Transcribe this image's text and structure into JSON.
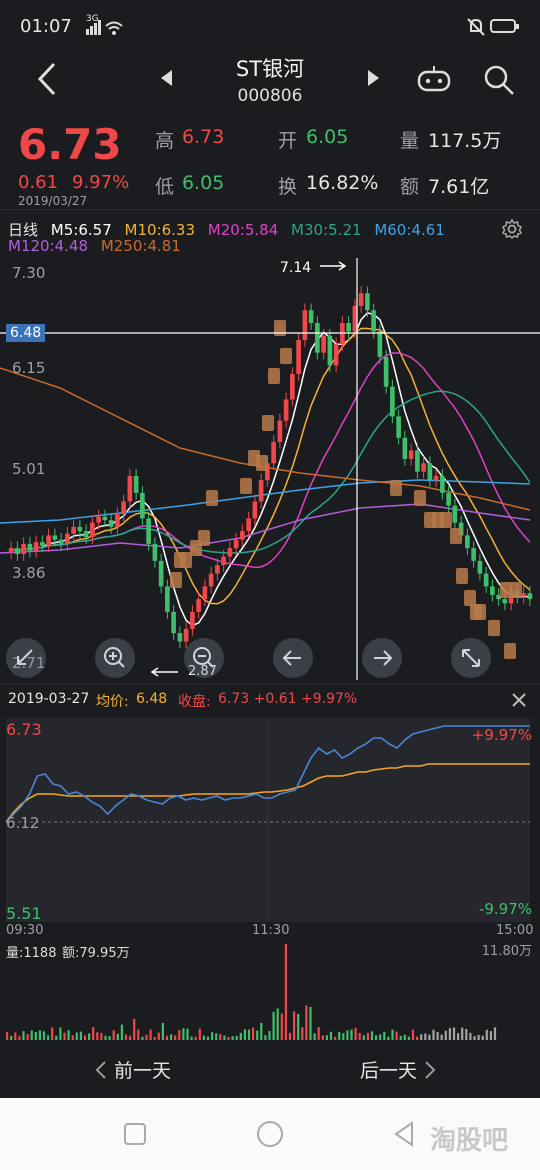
{
  "status_bar": {
    "time": "01:07",
    "signal": "3G",
    "battery": "battery"
  },
  "nav": {
    "title": "ST银河",
    "code": "000806"
  },
  "quote": {
    "price": "6.73",
    "change": "0.61",
    "change_pct": "9.97%",
    "date": "2019/03/27",
    "high_label": "高",
    "high": "6.73",
    "low_label": "低",
    "low": "6.05",
    "open_label": "开",
    "open": "6.05",
    "turnover_label": "换",
    "turnover": "16.82%",
    "volume_label": "量",
    "volume": "117.5万",
    "amount_label": "额",
    "amount": "7.61亿"
  },
  "ma_legend": {
    "period": "日线",
    "ma5": "M5:6.57",
    "ma10": "M10:6.33",
    "ma20": "M20:5.84",
    "ma30": "M30:5.21",
    "ma60": "M60:4.61",
    "ma120": "M120:4.48",
    "ma250": "M250:4.81"
  },
  "kline": {
    "y_labels": [
      "7.30",
      "6.15",
      "5.01",
      "3.86",
      "2.71"
    ],
    "crosshair_price": "6.48",
    "max_label": "7.14",
    "min_label": "2.87"
  },
  "intraday_header": {
    "date": "2019-03-27",
    "avg_label": "均价:",
    "avg": "6.48",
    "close_label": "收盘:",
    "close": "6.73 +0.61 +9.97%"
  },
  "intraday": {
    "top_price": "6.73",
    "mid_price": "6.12",
    "bottom_price": "5.51",
    "top_pct": "+9.97%",
    "bottom_pct": "-9.97%",
    "times": [
      "09:30",
      "11:30",
      "15:00"
    ]
  },
  "volume_panel": {
    "vol_text": "量:1188",
    "amt_text": "额:79.95万",
    "max_label": "11.80万"
  },
  "day_nav": {
    "prev": "前一天",
    "next": "后一天"
  },
  "watermark": "淘股吧",
  "colors": {
    "up": "#f04848",
    "down": "#3fbf6a",
    "ma5": "#ffffff",
    "ma10": "#f5b236",
    "ma20": "#e040c8",
    "ma30": "#2aa68a",
    "ma60": "#3ea3e8",
    "ma120": "#b060d8",
    "ma250": "#c86a2a"
  }
}
